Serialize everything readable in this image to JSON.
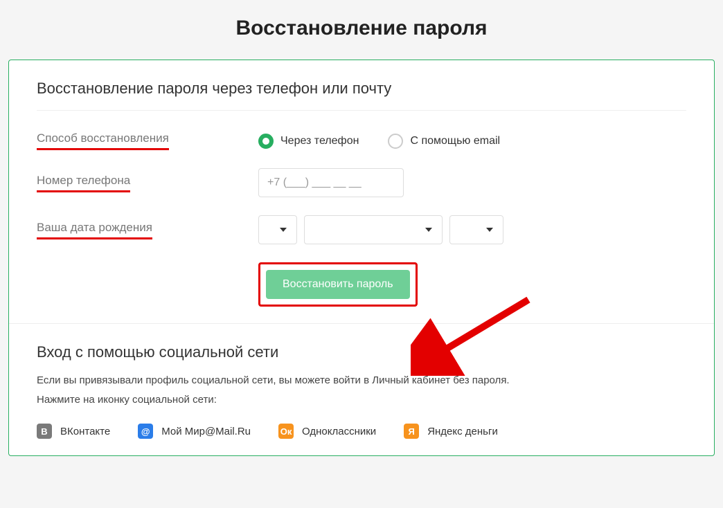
{
  "page": {
    "title": "Восстановление пароля"
  },
  "form": {
    "section_title": "Восстановление пароля через телефон или почту",
    "labels": {
      "method": "Способ восстановления",
      "phone": "Номер телефона",
      "birthdate": "Ваша дата рождения"
    },
    "method_options": {
      "phone": "Через телефон",
      "email": "С помощью email",
      "selected": "phone"
    },
    "phone_placeholder": "+7 (___) ___ __ __",
    "submit_label": "Восстановить пароль"
  },
  "social": {
    "title": "Вход с помощью социальной сети",
    "desc_line1": "Если вы привязывали профиль социальной сети, вы можете войти в Личный кабинет без пароля.",
    "desc_line2": "Нажмите на иконку социальной сети:",
    "links": {
      "vk": {
        "label": "ВКонтакте",
        "glyph": "B"
      },
      "mail": {
        "label": "Мой Мир@Mail.Ru",
        "glyph": "@"
      },
      "ok": {
        "label": "Одноклассники",
        "glyph": "Ок"
      },
      "yandex": {
        "label": "Яндекс деньги",
        "glyph": "Я"
      }
    }
  }
}
